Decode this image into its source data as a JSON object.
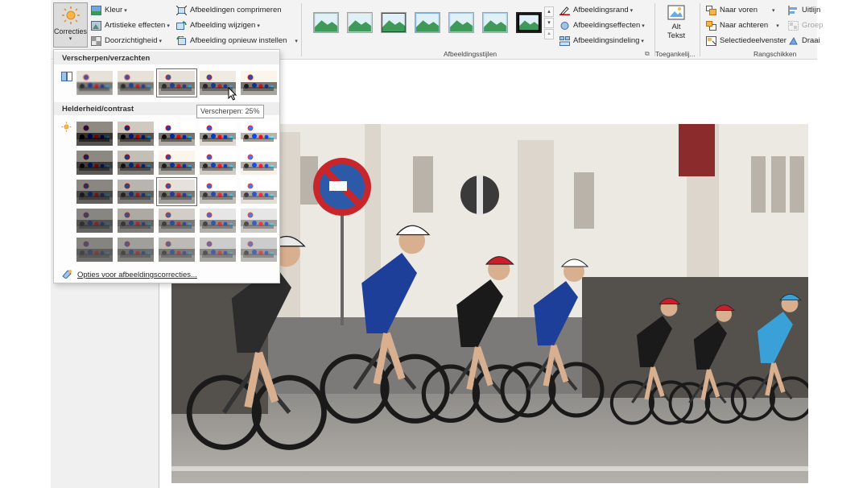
{
  "ribbon": {
    "corrections_label": "Correcties",
    "color_label": "Kleur",
    "artistic_label": "Artistieke effecten",
    "transparency_label": "Doorzichtigheid",
    "compress_label": "Afbeeldingen comprimeren",
    "change_label": "Afbeelding wijzigen",
    "reset_label": "Afbeelding opnieuw instellen",
    "styles_group_label": "Afbeeldingsstijlen",
    "border_label": "Afbeeldingsrand",
    "effects_label": "Afbeeldingseffecten",
    "layout_label": "Afbeeldingsindeling",
    "alt_label_1": "Alt",
    "alt_label_2": "Tekst",
    "accessibility_group_label": "Toegankelij...",
    "forward_label": "Naar voren",
    "backward_label": "Naar achteren",
    "selection_pane_label": "Selectiedeelvenster",
    "align_label": "Uitlijn",
    "group_label": "Groep",
    "rotate_label": "Draai",
    "arrange_group_label": "Rangschikken"
  },
  "corrections_panel": {
    "sharpen_heading": "Verscherpen/verzachten",
    "brightness_heading": "Helderheid/contrast",
    "tooltip": "Verscherpen: 25%",
    "options_link": "Opties voor afbeeldingscorrecties...",
    "sharpen_selected_index": 2,
    "brightness_selected": [
      2,
      2
    ]
  },
  "colors": {
    "ribbon_bg": "#f3f3f3",
    "accent": "#2b579a",
    "selected_bg": "#dcdcdc"
  }
}
